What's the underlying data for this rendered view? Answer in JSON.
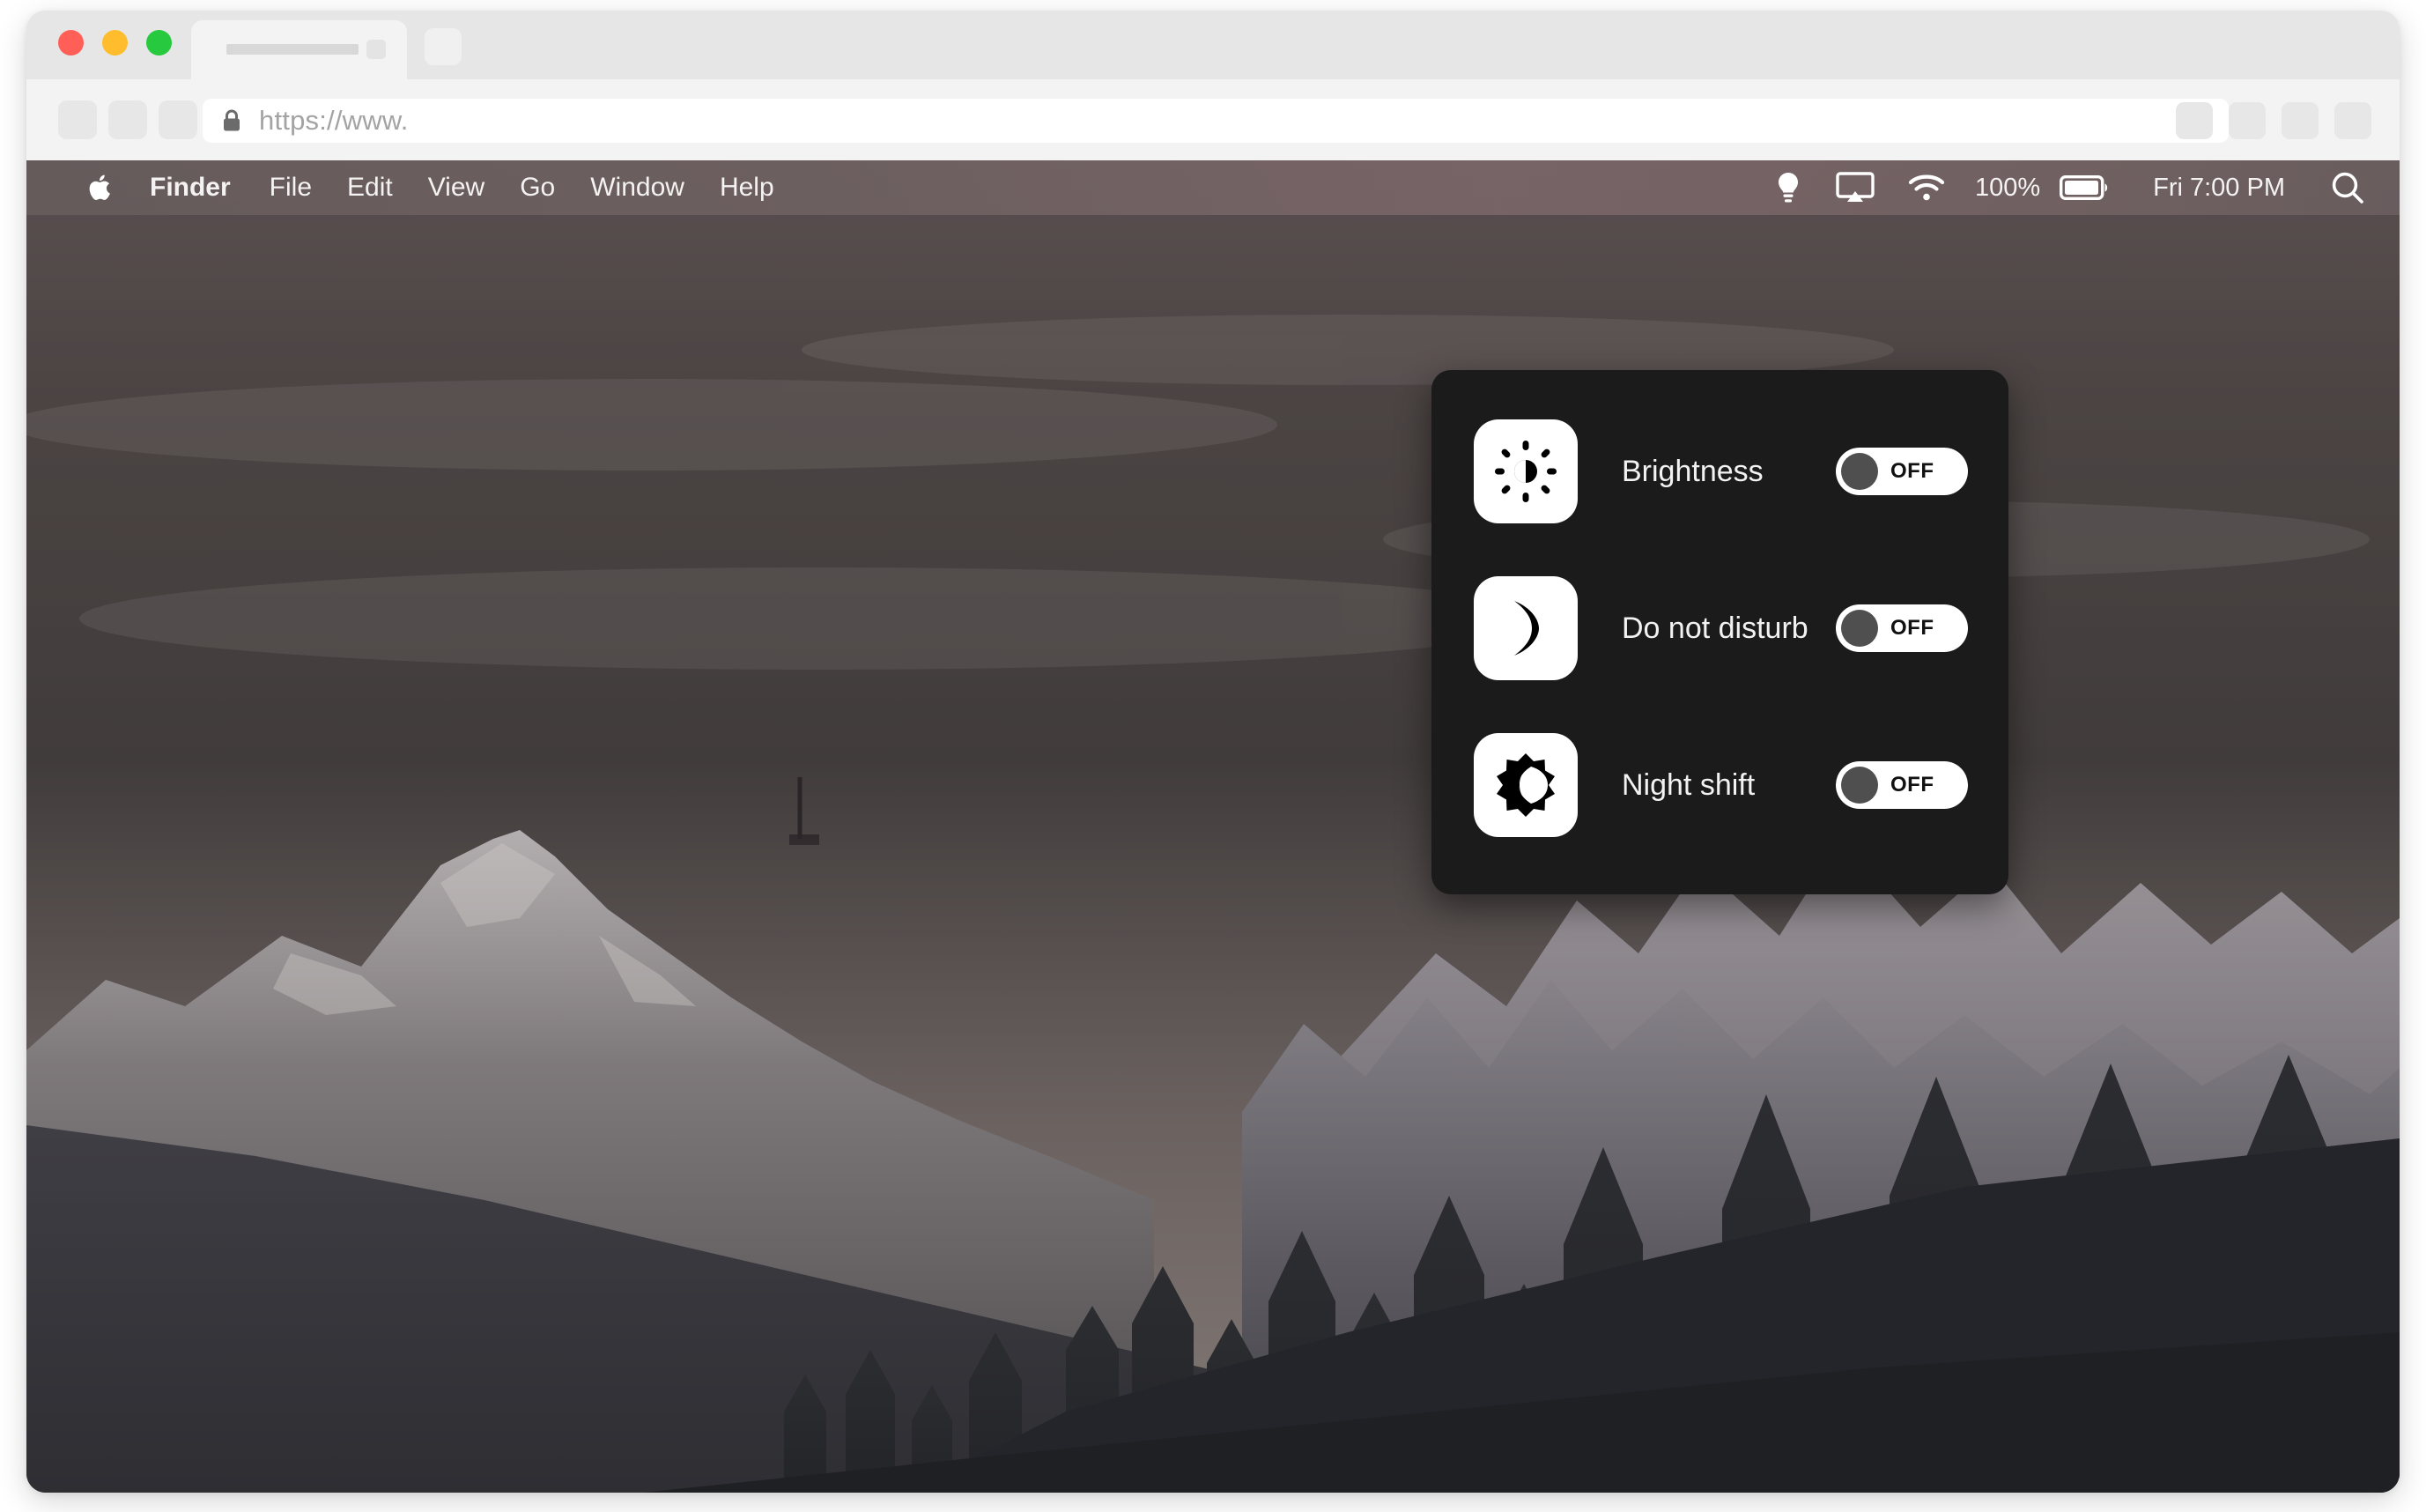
{
  "browser": {
    "traffic_lights": [
      {
        "name": "close",
        "color": "#ff5f56"
      },
      {
        "name": "minimize",
        "color": "#ffbd2e"
      },
      {
        "name": "maximize",
        "color": "#27c93f"
      }
    ],
    "tab": {
      "title": "",
      "close_label": ""
    },
    "new_tab_label": "",
    "address": {
      "url": "https://www.",
      "placeholder": "https://www.",
      "lock_icon": "lock-icon"
    },
    "toolbar_right_buttons": [
      "",
      "",
      "",
      ""
    ]
  },
  "menubar": {
    "apple_logo": "apple-logo-icon",
    "items": [
      {
        "label": "Finder",
        "bold": true
      },
      {
        "label": "File",
        "bold": false
      },
      {
        "label": "Edit",
        "bold": false
      },
      {
        "label": "View",
        "bold": false
      },
      {
        "label": "Go",
        "bold": false
      },
      {
        "label": "Window",
        "bold": false
      },
      {
        "label": "Help",
        "bold": false
      }
    ],
    "status": {
      "control_center_icon": "lightbulb-icon",
      "screen_mirroring_icon": "airplay-icon",
      "wifi_icon": "wifi-icon",
      "battery_percent": "100%",
      "battery_icon": "battery-full-icon",
      "clock": "Fri 7:00 PM",
      "search_icon": "search-icon"
    }
  },
  "control_center": {
    "rows": [
      {
        "icon": "brightness-icon",
        "label": "Brightness",
        "state": "OFF",
        "on": false
      },
      {
        "icon": "moon-icon",
        "label": "Do not disturb",
        "state": "OFF",
        "on": false
      },
      {
        "icon": "night-shift-icon",
        "label": "Night shift",
        "state": "OFF",
        "on": false
      }
    ]
  },
  "colors": {
    "panel_bg": "#1b1b1b",
    "toggle_track": "#ffffff",
    "toggle_knob": "#4f4f4f",
    "menubar_text": "#f4f2f2"
  }
}
